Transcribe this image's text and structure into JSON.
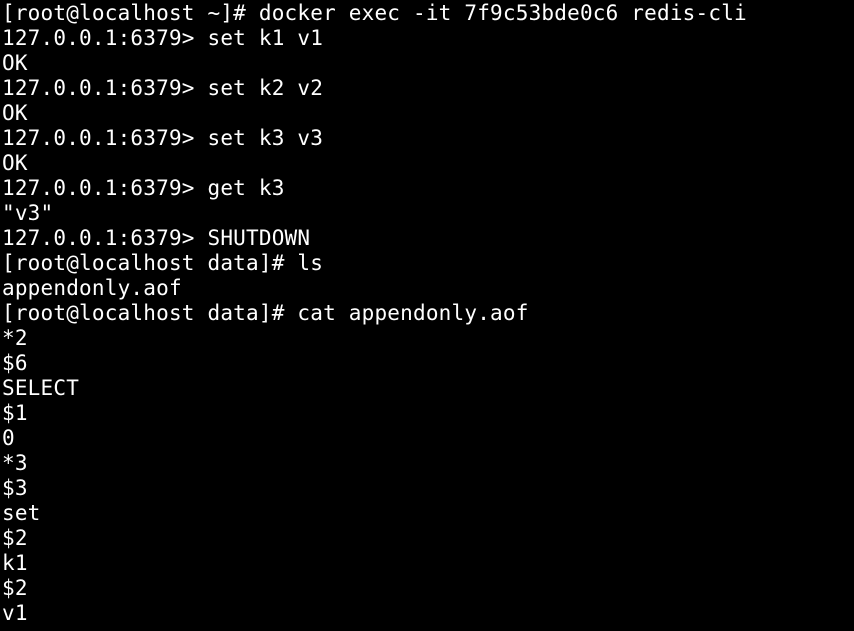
{
  "terminal": {
    "background": "#000000",
    "foreground": "#ffffff",
    "lines": [
      "[root@localhost ~]# docker exec -it 7f9c53bde0c6 redis-cli",
      "127.0.0.1:6379> set k1 v1",
      "OK",
      "127.0.0.1:6379> set k2 v2",
      "OK",
      "127.0.0.1:6379> set k3 v3",
      "OK",
      "127.0.0.1:6379> get k3",
      "\"v3\"",
      "127.0.0.1:6379> SHUTDOWN",
      "[root@localhost data]# ls",
      "appendonly.aof",
      "[root@localhost data]# cat appendonly.aof",
      "*2",
      "$6",
      "SELECT",
      "$1",
      "0",
      "*3",
      "$3",
      "set",
      "$2",
      "k1",
      "$2",
      "v1"
    ]
  }
}
